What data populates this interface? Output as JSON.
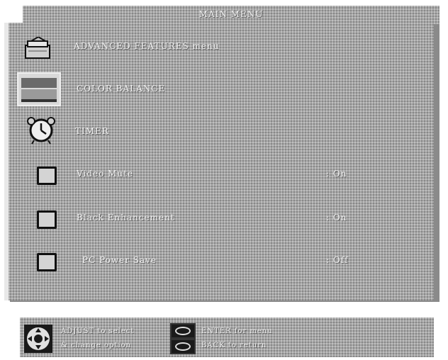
{
  "title": "MAIN MENU",
  "menu": {
    "advanced_label": "ADVANCED FEATURES menu",
    "color_label": "COLOR BALANCE",
    "timer_label": "TIMER",
    "options": [
      {
        "label": "Video Mute",
        "value": ": On"
      },
      {
        "label": "Black Enhancement",
        "value": ": On"
      },
      {
        "label": "PC Power Save",
        "value": ": Off"
      }
    ]
  },
  "help": {
    "select": "ADJUST to select",
    "change": "& change option",
    "enter": "ENTER for menu",
    "back": "BACK to return"
  },
  "icons": {
    "advanced": "stacked-panels-icon",
    "color": "color-bars-icon",
    "timer": "alarm-clock-icon",
    "navigation": "dpad-icon",
    "enter_key": "oval-button-icon",
    "back_key": "oval-button-icon"
  }
}
